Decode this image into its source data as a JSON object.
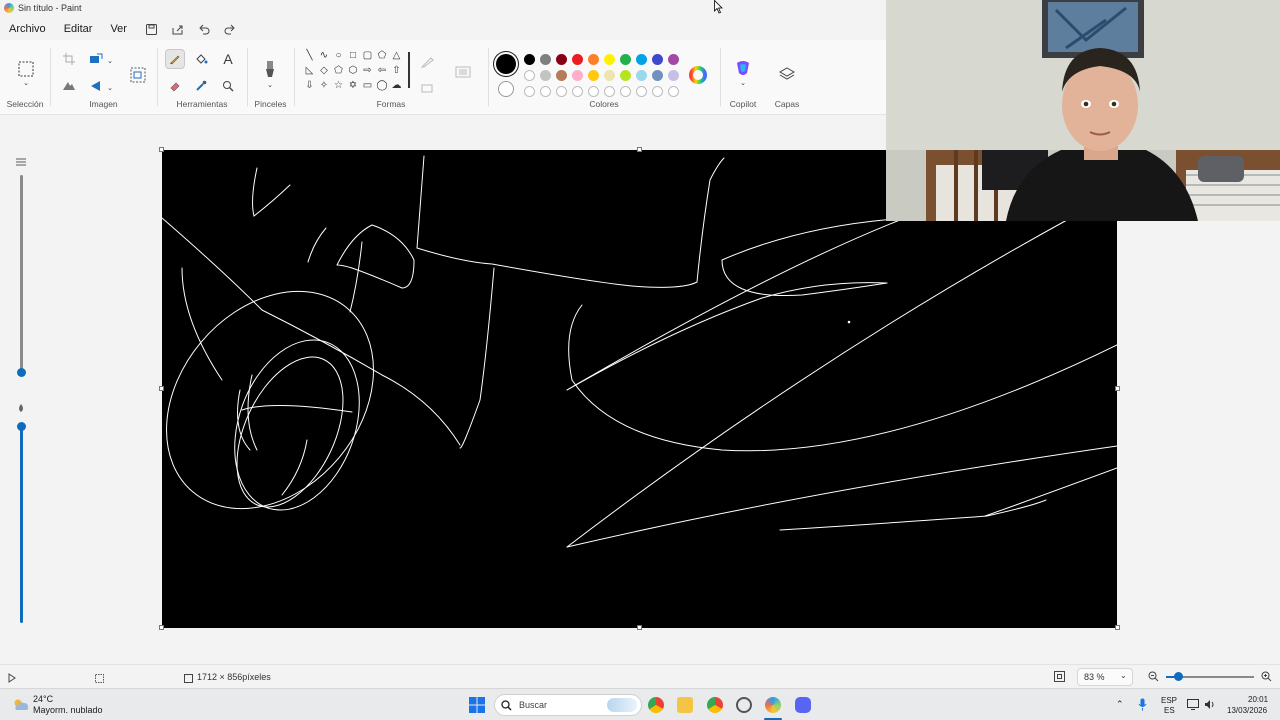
{
  "window": {
    "title": "Sin título - Paint"
  },
  "menu": {
    "archivo": "Archivo",
    "editar": "Editar",
    "ver": "Ver"
  },
  "ribbon": {
    "groups": {
      "seleccion": "Selección",
      "imagen": "Imagen",
      "herramientas": "Herramientas",
      "pinceles": "Pinceles",
      "formas": "Formas",
      "colores": "Colores",
      "copilot": "Copilot",
      "capas": "Capas"
    },
    "palette_row1": [
      "#000000",
      "#7f7f7f",
      "#880015",
      "#ed1c24",
      "#ff7f27",
      "#fff200",
      "#22b14c",
      "#00a2e8",
      "#3f48cc",
      "#a349a4"
    ],
    "palette_row2": [
      "#ffffff",
      "#c3c3c3",
      "#b97a57",
      "#ffaec9",
      "#ffc90e",
      "#efe4b0",
      "#b5e61d",
      "#99d9ea",
      "#7092be",
      "#c8bfe7"
    ],
    "selected_color": "#000000"
  },
  "canvas": {
    "background": "#000000",
    "stroke_color": "#ffffff"
  },
  "status": {
    "canvas_size": "1712 × 856píxeles",
    "zoom": "83 %"
  },
  "taskbar": {
    "weather_temp": "24°C",
    "weather_desc": "Mayorm. nublado",
    "search_placeholder": "Buscar",
    "lang_top": "ESP",
    "lang_bottom": "ES",
    "time": "20:01",
    "date": "13/03/2026"
  }
}
